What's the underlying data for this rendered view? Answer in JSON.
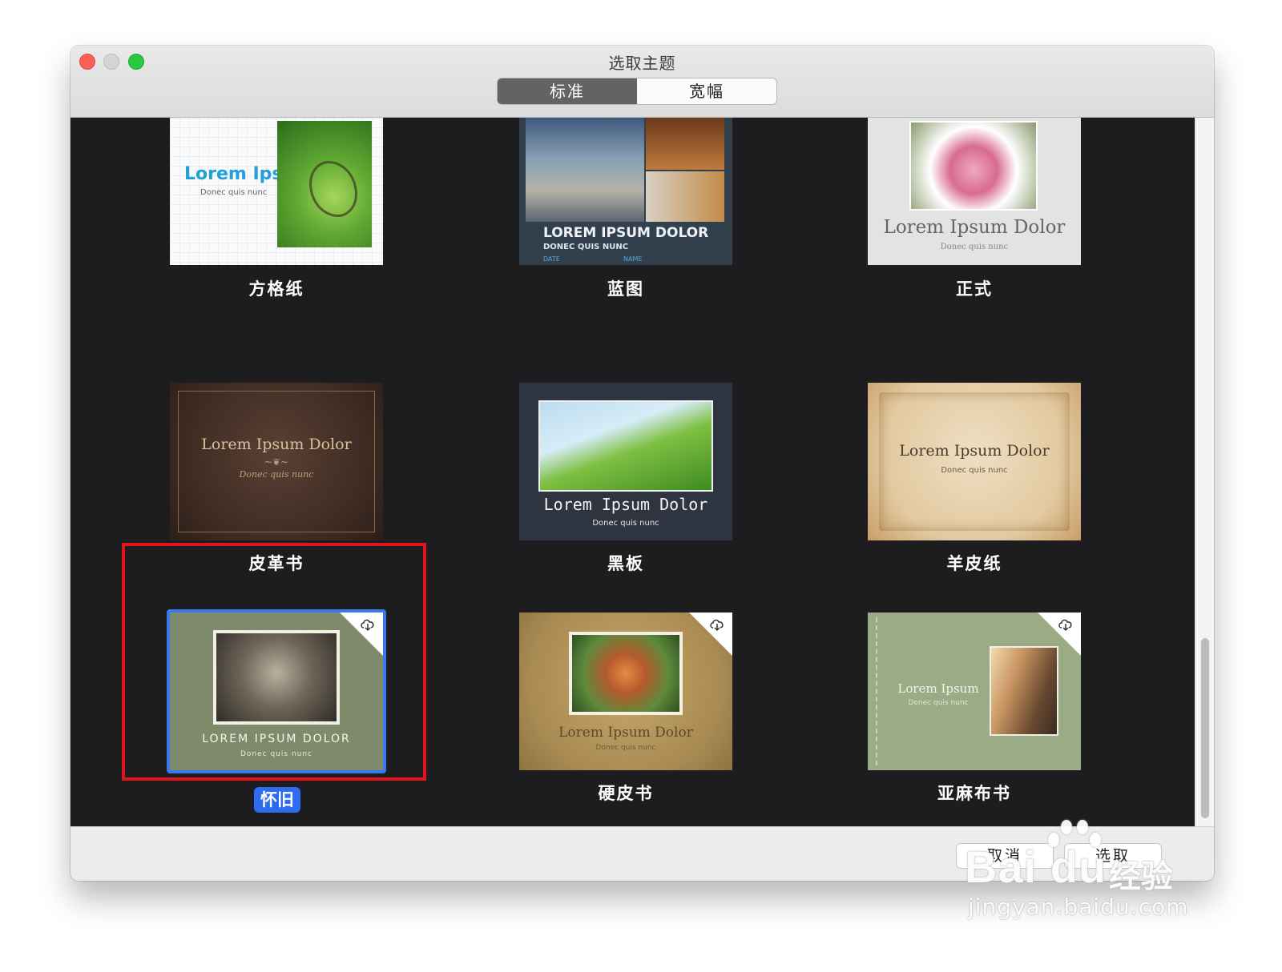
{
  "window": {
    "title": "选取主题",
    "segments": [
      {
        "label": "标准",
        "selected": true
      },
      {
        "label": "宽幅",
        "selected": false
      }
    ]
  },
  "themes": [
    {
      "label": "方格纸",
      "preview_title": "Lorem Ipsum",
      "preview_sub": "Donec quis nunc"
    },
    {
      "label": "蓝图",
      "preview_title": "LOREM IPSUM DOLOR",
      "preview_sub": "DONEC QUIS NUNC",
      "preview_date": "DATE",
      "preview_name": "NAME"
    },
    {
      "label": "正式",
      "preview_title": "Lorem Ipsum Dolor",
      "preview_sub": "Donec quis nunc"
    },
    {
      "label": "皮革书",
      "preview_title": "Lorem Ipsum Dolor",
      "preview_sub": "Donec quis nunc"
    },
    {
      "label": "黑板",
      "preview_title": "Lorem Ipsum Dolor",
      "preview_sub": "Donec quis nunc"
    },
    {
      "label": "羊皮纸",
      "preview_title": "Lorem Ipsum Dolor",
      "preview_sub": "Donec quis nunc"
    },
    {
      "label": "怀旧",
      "preview_title": "LOREM IPSUM DOLOR",
      "preview_sub": "Donec quis nunc",
      "selected": true,
      "download": true
    },
    {
      "label": "硬皮书",
      "preview_title": "Lorem Ipsum Dolor",
      "preview_sub": "Donec quis nunc",
      "download": true
    },
    {
      "label": "亚麻布书",
      "preview_title": "Lorem Ipsum",
      "preview_sub": "Donec quis nunc",
      "download": true
    }
  ],
  "footer": {
    "cancel_label": "取消",
    "choose_label": "选取"
  },
  "watermark": {
    "logo": "Bai du",
    "suffix": "经验",
    "url": "jingyan.baidu.com"
  },
  "icons": {
    "close": "close-icon",
    "minimize": "minimize-icon",
    "zoom": "zoom-icon",
    "download": "cloud-download-icon"
  },
  "colors": {
    "selection": "#2d6bf1",
    "annotation": "#e0141c",
    "content_bg": "#1d1d1f"
  }
}
